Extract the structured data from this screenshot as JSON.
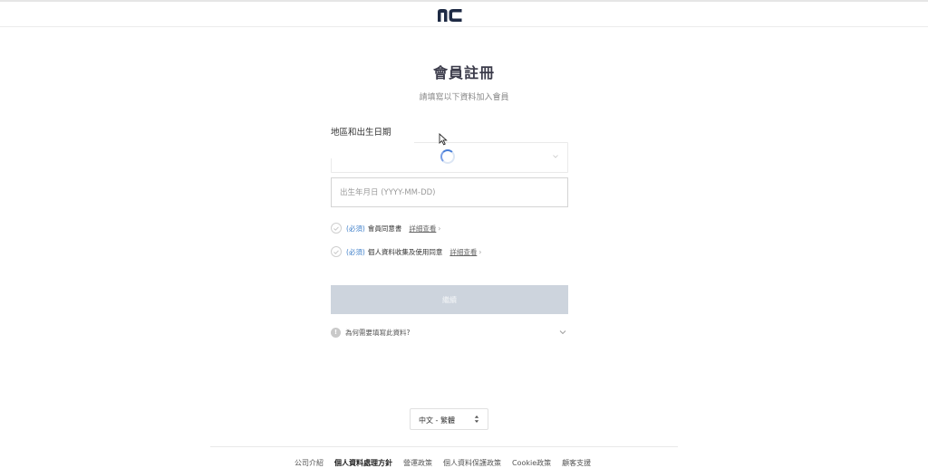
{
  "header": {
    "logo_icon": "nc-logo-icon"
  },
  "form": {
    "title": "會員註冊",
    "subtitle": "請填寫以下資料加入會員",
    "region_label": "地區和出生日期",
    "region_select": {
      "value": "",
      "loading": true
    },
    "dob": {
      "value": "",
      "placeholder": "出生年月日 (YYYY-MM-DD)"
    },
    "agreements": [
      {
        "required": "(必須)",
        "text": "會員同意書",
        "detail": "詳細查看"
      },
      {
        "required": "(必須)",
        "text": "個人資料收集及使用同意",
        "detail": "詳細查看"
      }
    ],
    "submit_label": "繼續",
    "why_text": "為何需要填寫此資料?"
  },
  "language": {
    "selected": "中文 - 繁體"
  },
  "footer": {
    "links": [
      {
        "label": "公司介紹",
        "bold": false
      },
      {
        "label": "個人資料處理方針",
        "bold": true
      },
      {
        "label": "營運政策",
        "bold": false
      },
      {
        "label": "個人資料保護政策",
        "bold": false
      },
      {
        "label": "Cookie政策",
        "bold": false
      },
      {
        "label": "顧客支援",
        "bold": false
      }
    ]
  },
  "colors": {
    "accent": "#3d7ec9",
    "disabled_button": "#cdd4dd",
    "logo": "#1e2a44"
  }
}
